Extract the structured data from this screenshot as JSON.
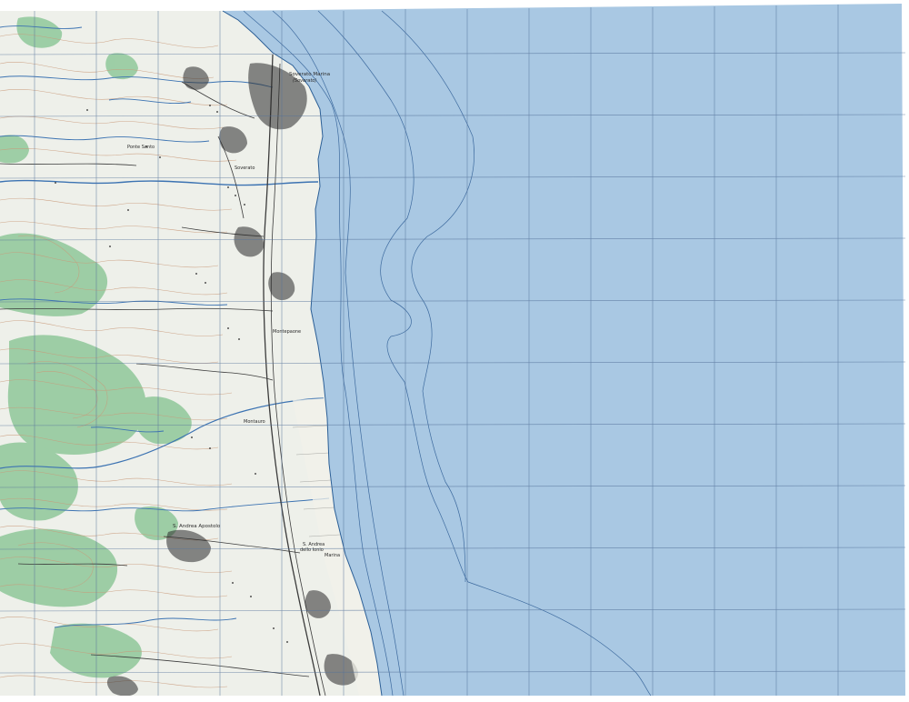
{
  "map": {
    "colors": {
      "sea": "#a9c8e3",
      "land": "#eef0ea",
      "forest": "#8fc89a",
      "contour": "#c99a7a",
      "water_line": "#3c73b2",
      "grid": "#55729a",
      "road": "#3b3b3b",
      "urban": "#2a2a2a",
      "beach": "#f2f1ea"
    },
    "labels": {
      "town_north": "Soverato Marina",
      "town_north_sub": "(Soverato)",
      "place_1": "Soverato",
      "place_2": "Montepaone",
      "place_3": "Montauro",
      "place_4": "Ponte Santo",
      "town_south": "S. Andrea Apostolo",
      "town_south_2": "S. Andrea",
      "town_south_3": "dello Ionio",
      "town_south_4": "Marina"
    }
  }
}
